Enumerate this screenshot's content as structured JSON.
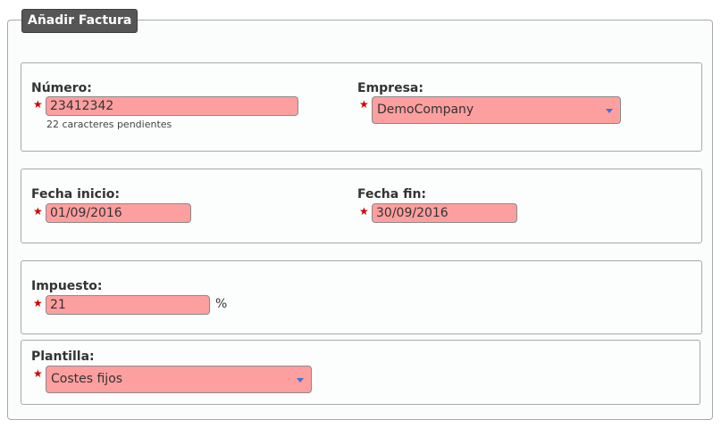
{
  "form": {
    "title": "Añadir Factura"
  },
  "numero": {
    "label": "Número:",
    "value": "23412342",
    "hint": "22 caracteres pendientes"
  },
  "empresa": {
    "label": "Empresa:",
    "value": "DemoCompany"
  },
  "fecha_inicio": {
    "label": "Fecha inicio:",
    "value": "01/09/2016"
  },
  "fecha_fin": {
    "label": "Fecha fin:",
    "value": "30/09/2016"
  },
  "impuesto": {
    "label": "Impuesto:",
    "value": "21",
    "unit": "%"
  },
  "plantilla": {
    "label": "Plantilla:",
    "value": "Costes fijos"
  },
  "required_marker": "★",
  "colors": {
    "required_field_bg": "#fd9f9f",
    "required_star": "#cc0000",
    "legend_bg": "#565656",
    "caret": "#3b73d8"
  }
}
